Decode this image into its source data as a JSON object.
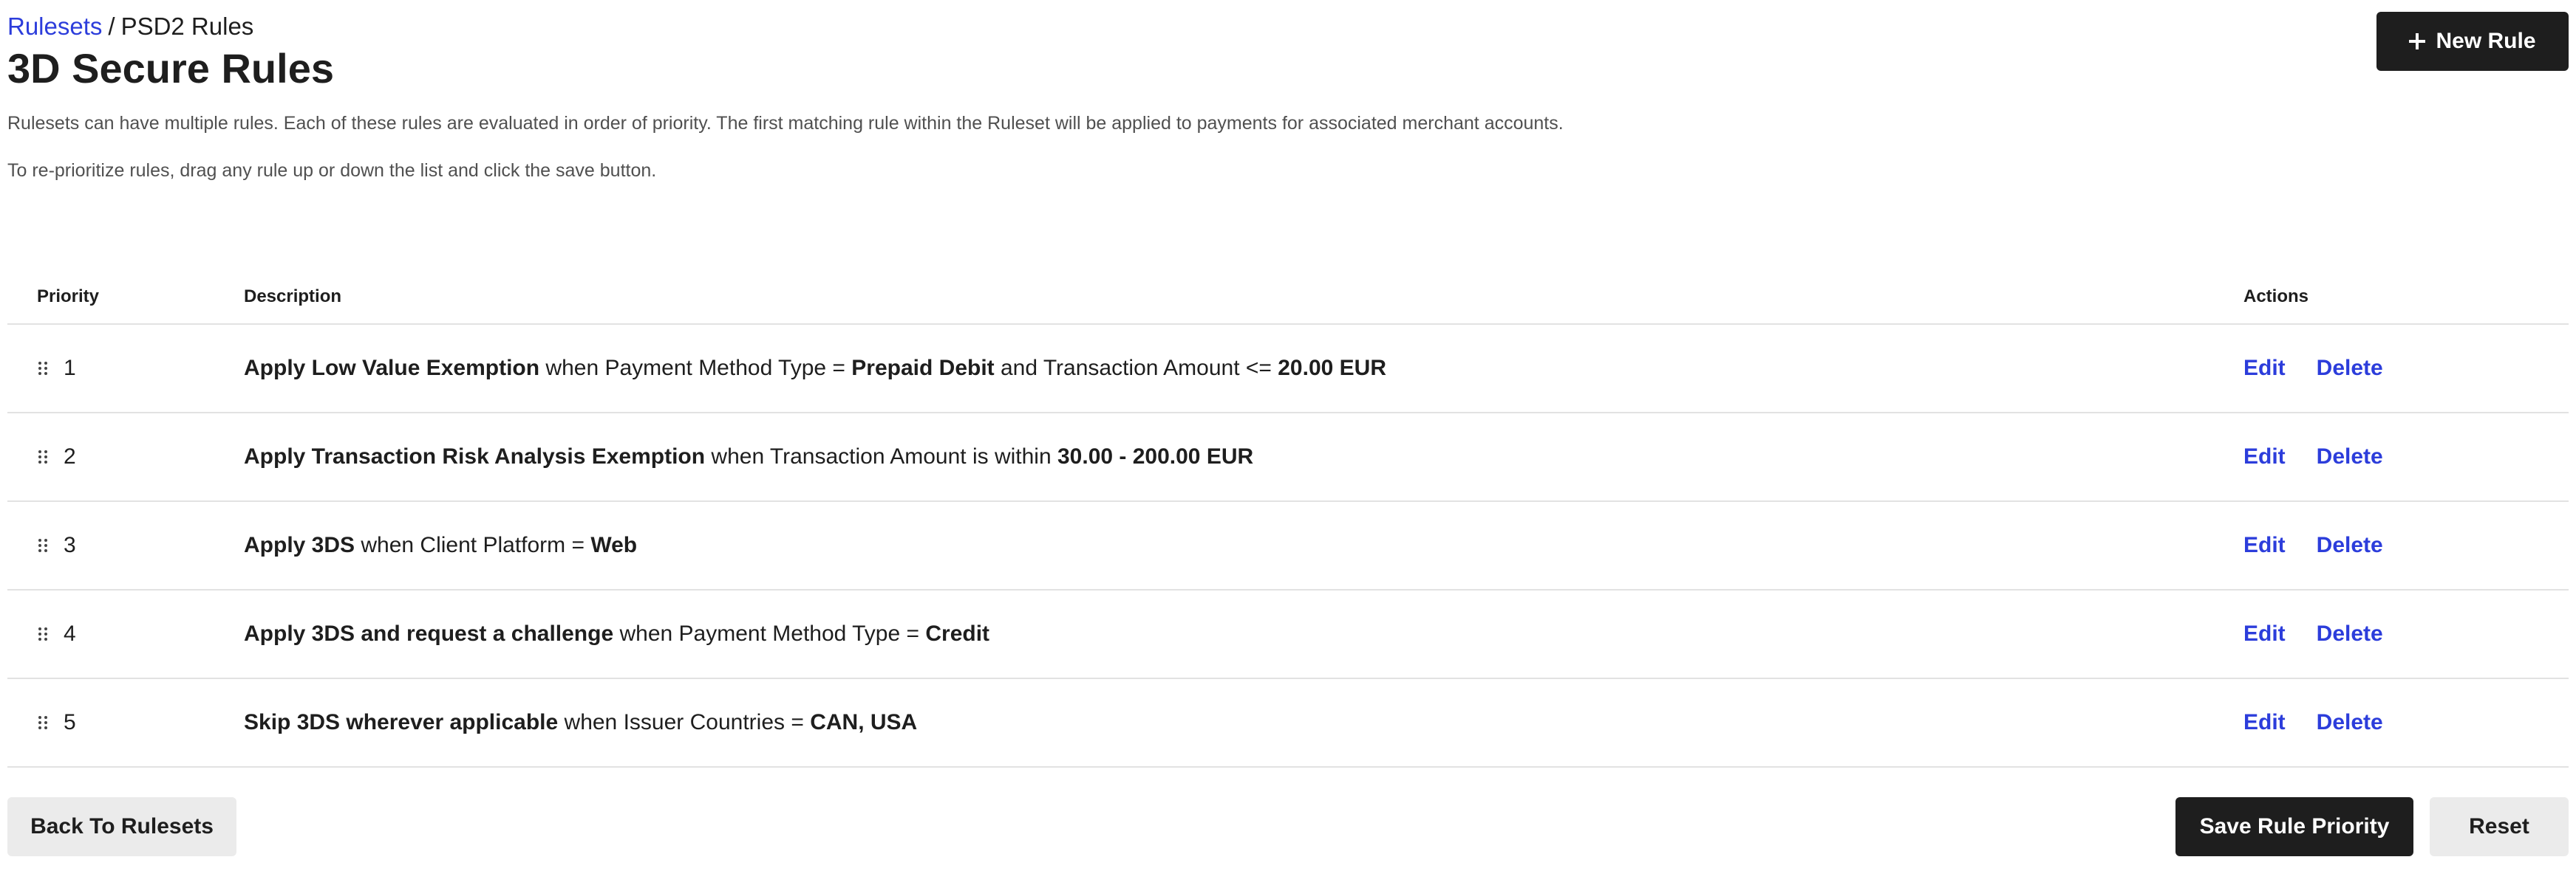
{
  "breadcrumb": {
    "parent_label": "Rulesets",
    "separator": "/",
    "current_label": "PSD2 Rules"
  },
  "page_title": "3D Secure Rules",
  "intro": {
    "p1": "Rulesets can have multiple rules. Each of these rules are evaluated in order of priority. The first matching rule within the Ruleset will be applied to payments for associated merchant accounts.",
    "p2": "To re-prioritize rules, drag any rule up or down the list and click the save button."
  },
  "header_actions": {
    "new_rule_label": "New Rule"
  },
  "table": {
    "columns": {
      "priority": "Priority",
      "description": "Description",
      "actions": "Actions"
    },
    "rows": [
      {
        "priority": "1",
        "desc": [
          {
            "text": "Apply Low Value Exemption",
            "bold": true
          },
          {
            "text": " when Payment Method Type = ",
            "bold": false
          },
          {
            "text": "Prepaid Debit",
            "bold": true
          },
          {
            "text": " and Transaction Amount <= ",
            "bold": false
          },
          {
            "text": "20.00 EUR",
            "bold": true
          }
        ],
        "edit_label": "Edit",
        "delete_label": "Delete"
      },
      {
        "priority": "2",
        "desc": [
          {
            "text": "Apply Transaction Risk Analysis Exemption",
            "bold": true
          },
          {
            "text": " when Transaction Amount is within ",
            "bold": false
          },
          {
            "text": "30.00 - 200.00 EUR",
            "bold": true
          }
        ],
        "edit_label": "Edit",
        "delete_label": "Delete"
      },
      {
        "priority": "3",
        "desc": [
          {
            "text": "Apply 3DS",
            "bold": true
          },
          {
            "text": " when Client Platform = ",
            "bold": false
          },
          {
            "text": "Web",
            "bold": true
          }
        ],
        "edit_label": "Edit",
        "delete_label": "Delete"
      },
      {
        "priority": "4",
        "desc": [
          {
            "text": "Apply 3DS and request a challenge",
            "bold": true
          },
          {
            "text": " when Payment Method Type = ",
            "bold": false
          },
          {
            "text": "Credit",
            "bold": true
          }
        ],
        "edit_label": "Edit",
        "delete_label": "Delete"
      },
      {
        "priority": "5",
        "desc": [
          {
            "text": "Skip 3DS wherever applicable",
            "bold": true
          },
          {
            "text": " when Issuer Countries = ",
            "bold": false
          },
          {
            "text": "CAN, USA",
            "bold": true
          }
        ],
        "edit_label": "Edit",
        "delete_label": "Delete"
      }
    ]
  },
  "footer": {
    "back_label": "Back To Rulesets",
    "save_label": "Save Rule Priority",
    "reset_label": "Reset"
  },
  "colors": {
    "link": "#2c3ddb",
    "primary_button": "#1e1e1e",
    "secondary_button": "#ebebeb",
    "divider": "#e2e2e2"
  },
  "icons": {
    "new_rule": "plus-icon",
    "row_handle": "drag-handle-icon"
  }
}
